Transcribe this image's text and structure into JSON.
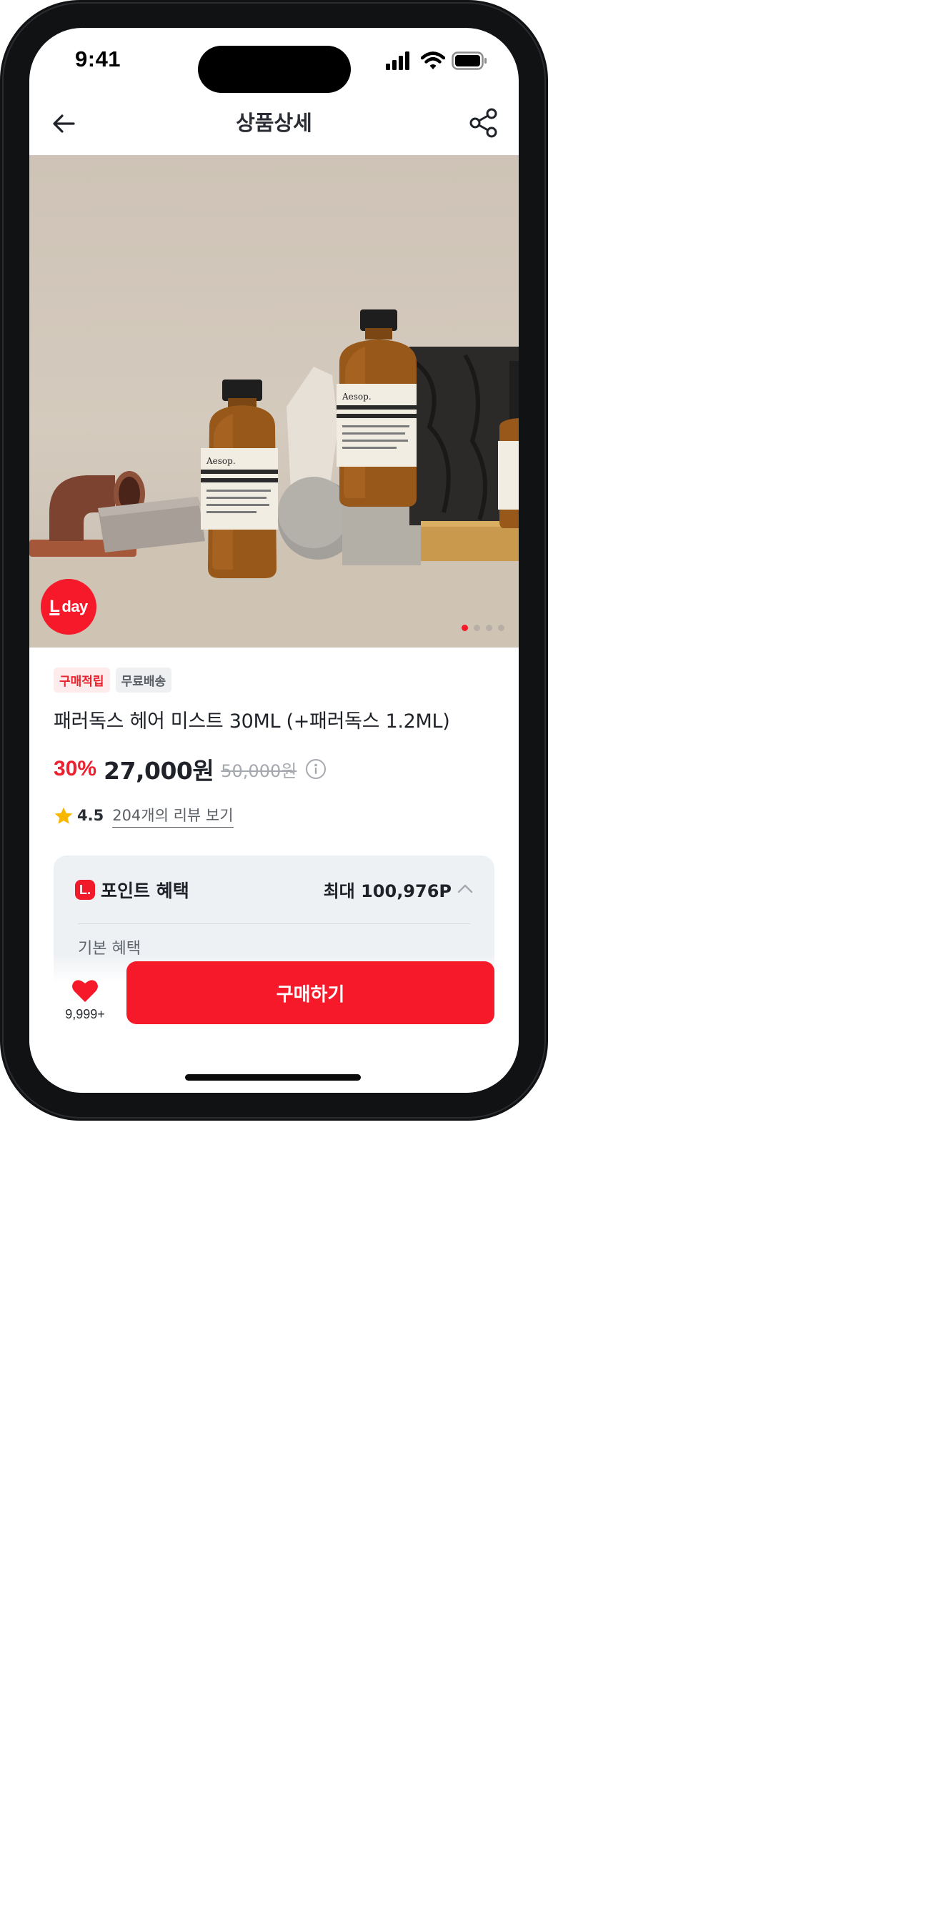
{
  "status_bar": {
    "time": "9:41"
  },
  "app_bar": {
    "title": "상품상세"
  },
  "hero": {
    "badge": {
      "prefix": "L",
      "text": "day"
    },
    "pager": {
      "total": 4,
      "active_index": 0
    },
    "product_label_brand": "Aesop."
  },
  "product": {
    "badges": [
      "구매적립",
      "무료배송"
    ],
    "name": "패러독스 헤어 미스트 30ML (+패러독스 1.2ML)",
    "discount": "30%",
    "price": "27,000원",
    "original_price": "50,000원",
    "rating": "4.5",
    "review_link": "204개의 리뷰 보기"
  },
  "benefit": {
    "icon_text": "L.",
    "title": "포인트 혜택",
    "max": "최대 100,976P",
    "sub_title": "기본 혜택"
  },
  "bottom_bar": {
    "wish_count": "9,999+",
    "buy_label": "구매하기"
  },
  "colors": {
    "accent": "#f5192a",
    "text": "#1f2329",
    "card_bg": "#eef1f4",
    "star": "#f8b800"
  },
  "icons": [
    "back-arrow-icon",
    "share-icon",
    "info-icon",
    "star-icon",
    "chevron-up-icon",
    "heart-icon",
    "signal-icon",
    "wifi-icon",
    "battery-icon"
  ]
}
